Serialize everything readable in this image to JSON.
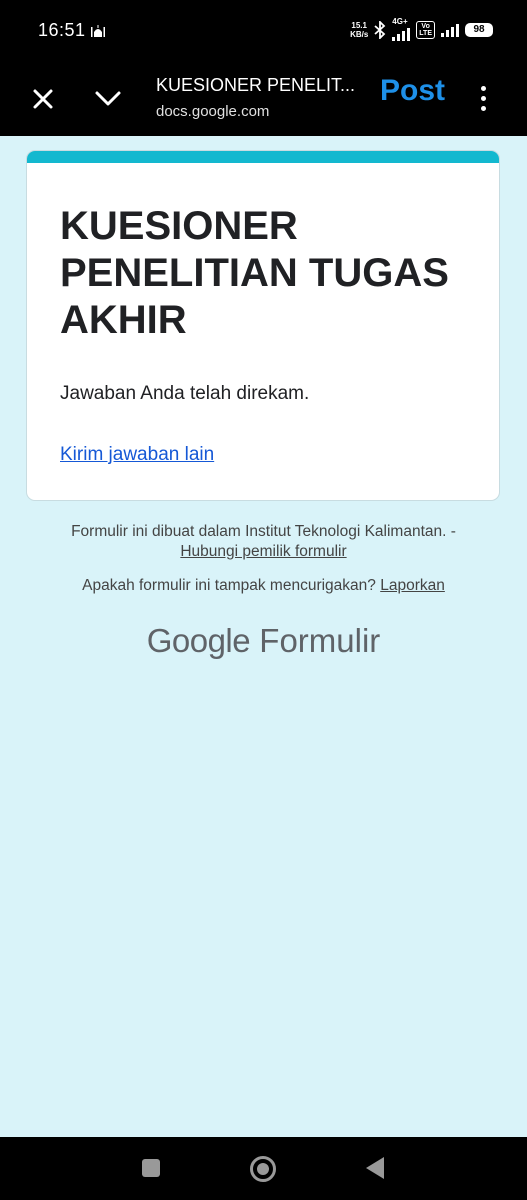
{
  "status_bar": {
    "time": "16:51",
    "speed_value": "15.1",
    "speed_unit": "KB/s",
    "network_label": "4G+",
    "volte_label_1": "Vo",
    "volte_label_2": "LTE",
    "battery": "98"
  },
  "toolbar": {
    "title": "KUESIONER PENELIT...",
    "url": "docs.google.com",
    "post_label": "Post"
  },
  "form": {
    "title": "KUESIONER PENELITIAN TUGAS AKHIR",
    "confirmation": "Jawaban Anda telah direkam.",
    "submit_another": "Kirim jawaban lain"
  },
  "footer": {
    "created_in": "Formulir ini dibuat dalam Institut Teknologi Kalimantan. -",
    "contact_owner": "Hubungi pemilik formulir",
    "report_question": "Apakah formulir ini tampak mencurigakan?",
    "report_link": "Laporkan",
    "brand_google": "Google",
    "brand_forms": "Formulir"
  },
  "colors": {
    "background": "#d9f3f9",
    "accent": "#13b8cf",
    "post_button": "#1e90e8",
    "link": "#1558d6"
  }
}
